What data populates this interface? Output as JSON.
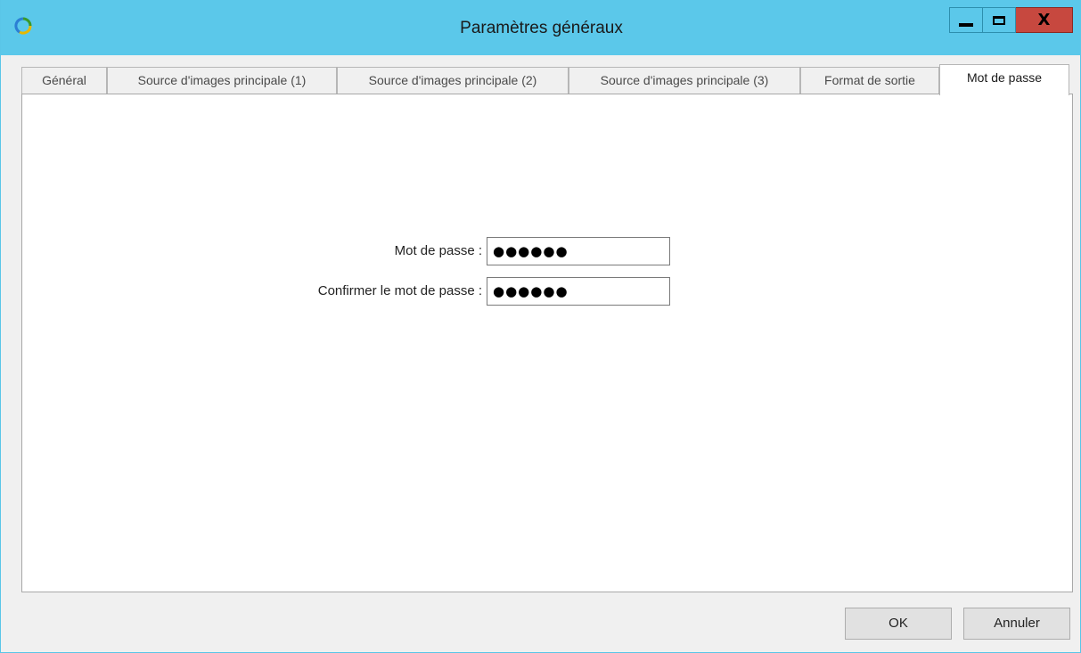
{
  "window": {
    "title": "Paramètres généraux",
    "controls": {
      "minimize": "minimize",
      "maximize": "maximize",
      "close": "X"
    }
  },
  "tabs": [
    {
      "label": "Général",
      "active": false
    },
    {
      "label": "Source d'images principale (1)",
      "active": false
    },
    {
      "label": "Source d'images principale (2)",
      "active": false
    },
    {
      "label": "Source d'images principale (3)",
      "active": false
    },
    {
      "label": "Format de sortie",
      "active": false
    },
    {
      "label": "Mot de passe",
      "active": true
    }
  ],
  "form": {
    "password_label": "Mot de passe :",
    "password_value": "●●●●●●",
    "confirm_label": "Confirmer le mot de passe :",
    "confirm_value": "●●●●●●"
  },
  "buttons": {
    "ok": "OK",
    "cancel": "Annuler"
  },
  "colors": {
    "titlebar": "#5bc8ea",
    "close_button": "#c7483f"
  },
  "icons": {
    "app": "refresh-circle-icon"
  }
}
